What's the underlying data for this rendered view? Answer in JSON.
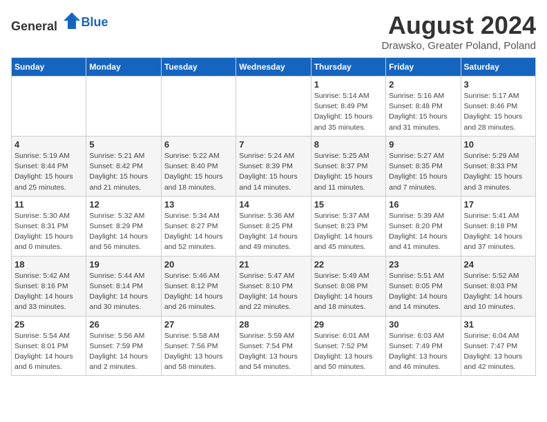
{
  "header": {
    "logo_general": "General",
    "logo_blue": "Blue",
    "title": "August 2024",
    "subtitle": "Drawsko, Greater Poland, Poland"
  },
  "weekdays": [
    "Sunday",
    "Monday",
    "Tuesday",
    "Wednesday",
    "Thursday",
    "Friday",
    "Saturday"
  ],
  "weeks": [
    [
      {
        "day": "",
        "info": ""
      },
      {
        "day": "",
        "info": ""
      },
      {
        "day": "",
        "info": ""
      },
      {
        "day": "",
        "info": ""
      },
      {
        "day": "1",
        "info": "Sunrise: 5:14 AM\nSunset: 8:49 PM\nDaylight: 15 hours\nand 35 minutes."
      },
      {
        "day": "2",
        "info": "Sunrise: 5:16 AM\nSunset: 8:48 PM\nDaylight: 15 hours\nand 31 minutes."
      },
      {
        "day": "3",
        "info": "Sunrise: 5:17 AM\nSunset: 8:46 PM\nDaylight: 15 hours\nand 28 minutes."
      }
    ],
    [
      {
        "day": "4",
        "info": "Sunrise: 5:19 AM\nSunset: 8:44 PM\nDaylight: 15 hours\nand 25 minutes."
      },
      {
        "day": "5",
        "info": "Sunrise: 5:21 AM\nSunset: 8:42 PM\nDaylight: 15 hours\nand 21 minutes."
      },
      {
        "day": "6",
        "info": "Sunrise: 5:22 AM\nSunset: 8:40 PM\nDaylight: 15 hours\nand 18 minutes."
      },
      {
        "day": "7",
        "info": "Sunrise: 5:24 AM\nSunset: 8:39 PM\nDaylight: 15 hours\nand 14 minutes."
      },
      {
        "day": "8",
        "info": "Sunrise: 5:25 AM\nSunset: 8:37 PM\nDaylight: 15 hours\nand 11 minutes."
      },
      {
        "day": "9",
        "info": "Sunrise: 5:27 AM\nSunset: 8:35 PM\nDaylight: 15 hours\nand 7 minutes."
      },
      {
        "day": "10",
        "info": "Sunrise: 5:29 AM\nSunset: 8:33 PM\nDaylight: 15 hours\nand 3 minutes."
      }
    ],
    [
      {
        "day": "11",
        "info": "Sunrise: 5:30 AM\nSunset: 8:31 PM\nDaylight: 15 hours\nand 0 minutes."
      },
      {
        "day": "12",
        "info": "Sunrise: 5:32 AM\nSunset: 8:29 PM\nDaylight: 14 hours\nand 56 minutes."
      },
      {
        "day": "13",
        "info": "Sunrise: 5:34 AM\nSunset: 8:27 PM\nDaylight: 14 hours\nand 52 minutes."
      },
      {
        "day": "14",
        "info": "Sunrise: 5:36 AM\nSunset: 8:25 PM\nDaylight: 14 hours\nand 49 minutes."
      },
      {
        "day": "15",
        "info": "Sunrise: 5:37 AM\nSunset: 8:23 PM\nDaylight: 14 hours\nand 45 minutes."
      },
      {
        "day": "16",
        "info": "Sunrise: 5:39 AM\nSunset: 8:20 PM\nDaylight: 14 hours\nand 41 minutes."
      },
      {
        "day": "17",
        "info": "Sunrise: 5:41 AM\nSunset: 8:18 PM\nDaylight: 14 hours\nand 37 minutes."
      }
    ],
    [
      {
        "day": "18",
        "info": "Sunrise: 5:42 AM\nSunset: 8:16 PM\nDaylight: 14 hours\nand 33 minutes."
      },
      {
        "day": "19",
        "info": "Sunrise: 5:44 AM\nSunset: 8:14 PM\nDaylight: 14 hours\nand 30 minutes."
      },
      {
        "day": "20",
        "info": "Sunrise: 5:46 AM\nSunset: 8:12 PM\nDaylight: 14 hours\nand 26 minutes."
      },
      {
        "day": "21",
        "info": "Sunrise: 5:47 AM\nSunset: 8:10 PM\nDaylight: 14 hours\nand 22 minutes."
      },
      {
        "day": "22",
        "info": "Sunrise: 5:49 AM\nSunset: 8:08 PM\nDaylight: 14 hours\nand 18 minutes."
      },
      {
        "day": "23",
        "info": "Sunrise: 5:51 AM\nSunset: 8:05 PM\nDaylight: 14 hours\nand 14 minutes."
      },
      {
        "day": "24",
        "info": "Sunrise: 5:52 AM\nSunset: 8:03 PM\nDaylight: 14 hours\nand 10 minutes."
      }
    ],
    [
      {
        "day": "25",
        "info": "Sunrise: 5:54 AM\nSunset: 8:01 PM\nDaylight: 14 hours\nand 6 minutes."
      },
      {
        "day": "26",
        "info": "Sunrise: 5:56 AM\nSunset: 7:59 PM\nDaylight: 14 hours\nand 2 minutes."
      },
      {
        "day": "27",
        "info": "Sunrise: 5:58 AM\nSunset: 7:56 PM\nDaylight: 13 hours\nand 58 minutes."
      },
      {
        "day": "28",
        "info": "Sunrise: 5:59 AM\nSunset: 7:54 PM\nDaylight: 13 hours\nand 54 minutes."
      },
      {
        "day": "29",
        "info": "Sunrise: 6:01 AM\nSunset: 7:52 PM\nDaylight: 13 hours\nand 50 minutes."
      },
      {
        "day": "30",
        "info": "Sunrise: 6:03 AM\nSunset: 7:49 PM\nDaylight: 13 hours\nand 46 minutes."
      },
      {
        "day": "31",
        "info": "Sunrise: 6:04 AM\nSunset: 7:47 PM\nDaylight: 13 hours\nand 42 minutes."
      }
    ]
  ]
}
